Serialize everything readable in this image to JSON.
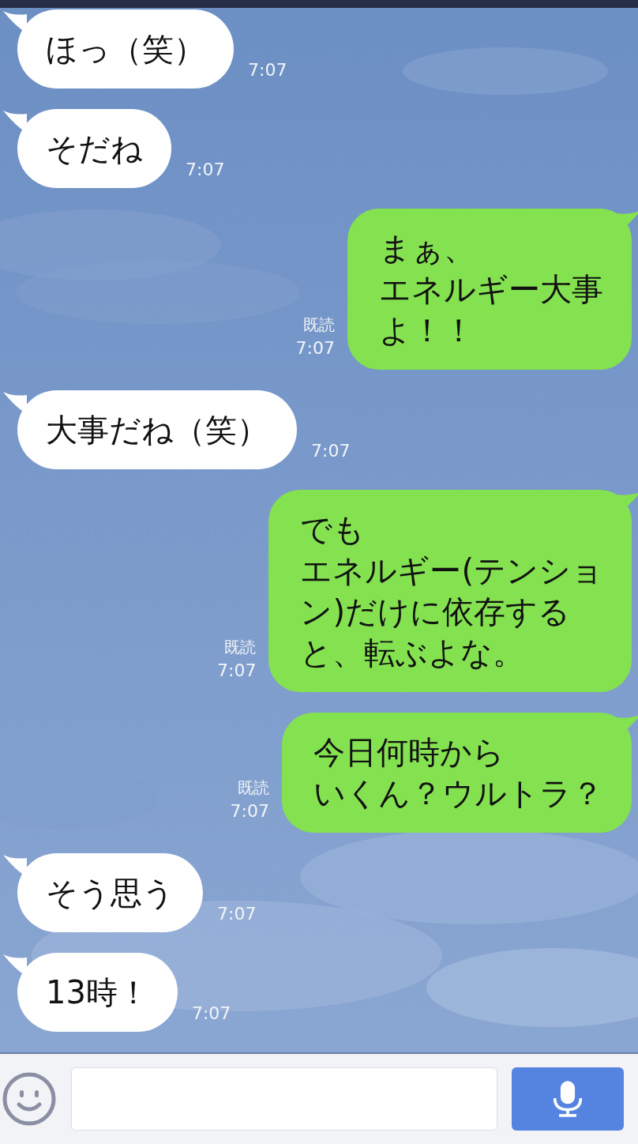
{
  "messages": [
    {
      "kind": "incoming",
      "lines": [
        "ほっ（笑）"
      ],
      "time": "7:07"
    },
    {
      "kind": "incoming",
      "lines": [
        "そだね"
      ],
      "time": "7:07"
    },
    {
      "kind": "outgoing",
      "lines": [
        "まぁ、",
        "エネルギー大事",
        "よ！！"
      ],
      "read_label": "既読",
      "time": "7:07"
    },
    {
      "kind": "incoming",
      "lines": [
        "大事だね（笑）"
      ],
      "time": "7:07"
    },
    {
      "kind": "outgoing",
      "lines": [
        "でも",
        "エネルギー(テンショ",
        "ン)だけに依存する",
        "と、転ぶよな。"
      ],
      "read_label": "既読",
      "time": "7:07"
    },
    {
      "kind": "outgoing",
      "lines": [
        "今日何時から",
        "いくん？ウルトラ？"
      ],
      "read_label": "既読",
      "time": "7:07"
    },
    {
      "kind": "incoming",
      "lines": [
        "そう思う"
      ],
      "time": "7:07"
    },
    {
      "kind": "incoming",
      "lines": [
        "13時！"
      ],
      "time": "7:07"
    }
  ]
}
